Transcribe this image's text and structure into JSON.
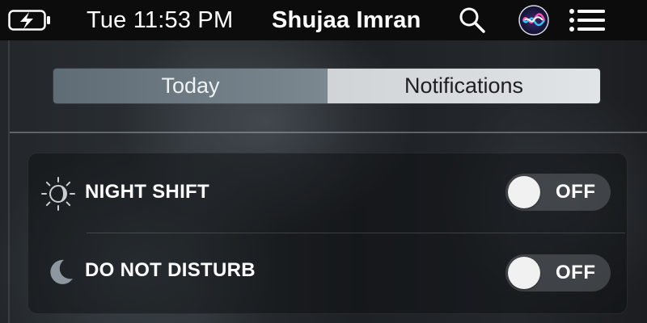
{
  "menu_bar": {
    "battery": {
      "icon": "battery-charging-icon"
    },
    "clock": "Tue 11:53 PM",
    "user_name": "Shujaa Imran",
    "spotlight": {
      "icon": "search-icon"
    },
    "siri": {
      "icon": "siri-icon"
    },
    "notification_center": {
      "icon": "notification-center-icon"
    }
  },
  "tabs": [
    {
      "label": "Today",
      "selected": false
    },
    {
      "label": "Notifications",
      "selected": true
    }
  ],
  "widgets": [
    {
      "icon": "night-shift-icon",
      "label": "NIGHT SHIFT",
      "toggle_state": "OFF"
    },
    {
      "icon": "moon-icon",
      "label": "DO NOT DISTURB",
      "toggle_state": "OFF"
    }
  ],
  "colors": {
    "menu_bar_bg": "#0c0c0d",
    "tab_selected_bg": "#e1e4e6",
    "tab_unselected_bg": "#7c8890",
    "toggle_off_bg": "#6e7378",
    "knob": "#f1f1f1",
    "text": "#ffffff"
  }
}
